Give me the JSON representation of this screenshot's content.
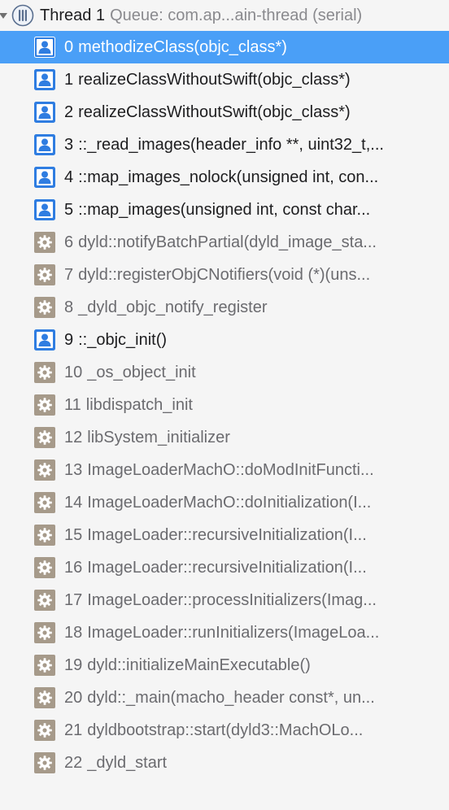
{
  "thread": {
    "name": "Thread 1",
    "queue": "Queue: com.ap...ain-thread (serial)"
  },
  "colors": {
    "selection": "#4a9ff7",
    "user_icon": "#2f7de1",
    "system_icon": "#a69a8a",
    "text": "#1d1d1f",
    "dim_text": "#6b6b6f"
  },
  "frames": [
    {
      "num": "0",
      "label": "methodizeClass(objc_class*)",
      "kind": "user",
      "icon": "user-frame-icon",
      "selected": true
    },
    {
      "num": "1",
      "label": "realizeClassWithoutSwift(objc_class*)",
      "kind": "user",
      "icon": "user-frame-icon"
    },
    {
      "num": "2",
      "label": "realizeClassWithoutSwift(objc_class*)",
      "kind": "user",
      "icon": "user-frame-icon"
    },
    {
      "num": "3",
      "label": "::_read_images(header_info **, uint32_t,...",
      "kind": "user",
      "icon": "user-frame-icon"
    },
    {
      "num": "4",
      "label": "::map_images_nolock(unsigned int, con...",
      "kind": "user",
      "icon": "user-frame-icon"
    },
    {
      "num": "5",
      "label": "::map_images(unsigned int, const char...",
      "kind": "user",
      "icon": "user-frame-icon"
    },
    {
      "num": "6",
      "label": "dyld::notifyBatchPartial(dyld_image_sta...",
      "kind": "system",
      "icon": "system-frame-icon"
    },
    {
      "num": "7",
      "label": "dyld::registerObjCNotifiers(void (*)(uns...",
      "kind": "system",
      "icon": "system-frame-icon"
    },
    {
      "num": "8",
      "label": "_dyld_objc_notify_register",
      "kind": "system",
      "icon": "system-frame-icon"
    },
    {
      "num": "9",
      "label": "::_objc_init()",
      "kind": "user",
      "icon": "user-frame-icon"
    },
    {
      "num": "10",
      "label": "_os_object_init",
      "kind": "system",
      "icon": "system-frame-icon"
    },
    {
      "num": "11",
      "label": "libdispatch_init",
      "kind": "system",
      "icon": "system-frame-icon"
    },
    {
      "num": "12",
      "label": "libSystem_initializer",
      "kind": "system",
      "icon": "system-frame-icon"
    },
    {
      "num": "13",
      "label": "ImageLoaderMachO::doModInitFuncti...",
      "kind": "system",
      "icon": "system-frame-icon"
    },
    {
      "num": "14",
      "label": "ImageLoaderMachO::doInitialization(I...",
      "kind": "system",
      "icon": "system-frame-icon"
    },
    {
      "num": "15",
      "label": "ImageLoader::recursiveInitialization(I...",
      "kind": "system",
      "icon": "system-frame-icon"
    },
    {
      "num": "16",
      "label": "ImageLoader::recursiveInitialization(I...",
      "kind": "system",
      "icon": "system-frame-icon"
    },
    {
      "num": "17",
      "label": "ImageLoader::processInitializers(Imag...",
      "kind": "system",
      "icon": "system-frame-icon"
    },
    {
      "num": "18",
      "label": "ImageLoader::runInitializers(ImageLoa...",
      "kind": "system",
      "icon": "system-frame-icon"
    },
    {
      "num": "19",
      "label": "dyld::initializeMainExecutable()",
      "kind": "system",
      "icon": "system-frame-icon"
    },
    {
      "num": "20",
      "label": "dyld::_main(macho_header const*, un...",
      "kind": "system",
      "icon": "system-frame-icon"
    },
    {
      "num": "21",
      "label": "dyldbootstrap::start(dyld3::MachOLo...",
      "kind": "system",
      "icon": "system-frame-icon"
    },
    {
      "num": "22",
      "label": "_dyld_start",
      "kind": "system",
      "icon": "system-frame-icon"
    }
  ]
}
